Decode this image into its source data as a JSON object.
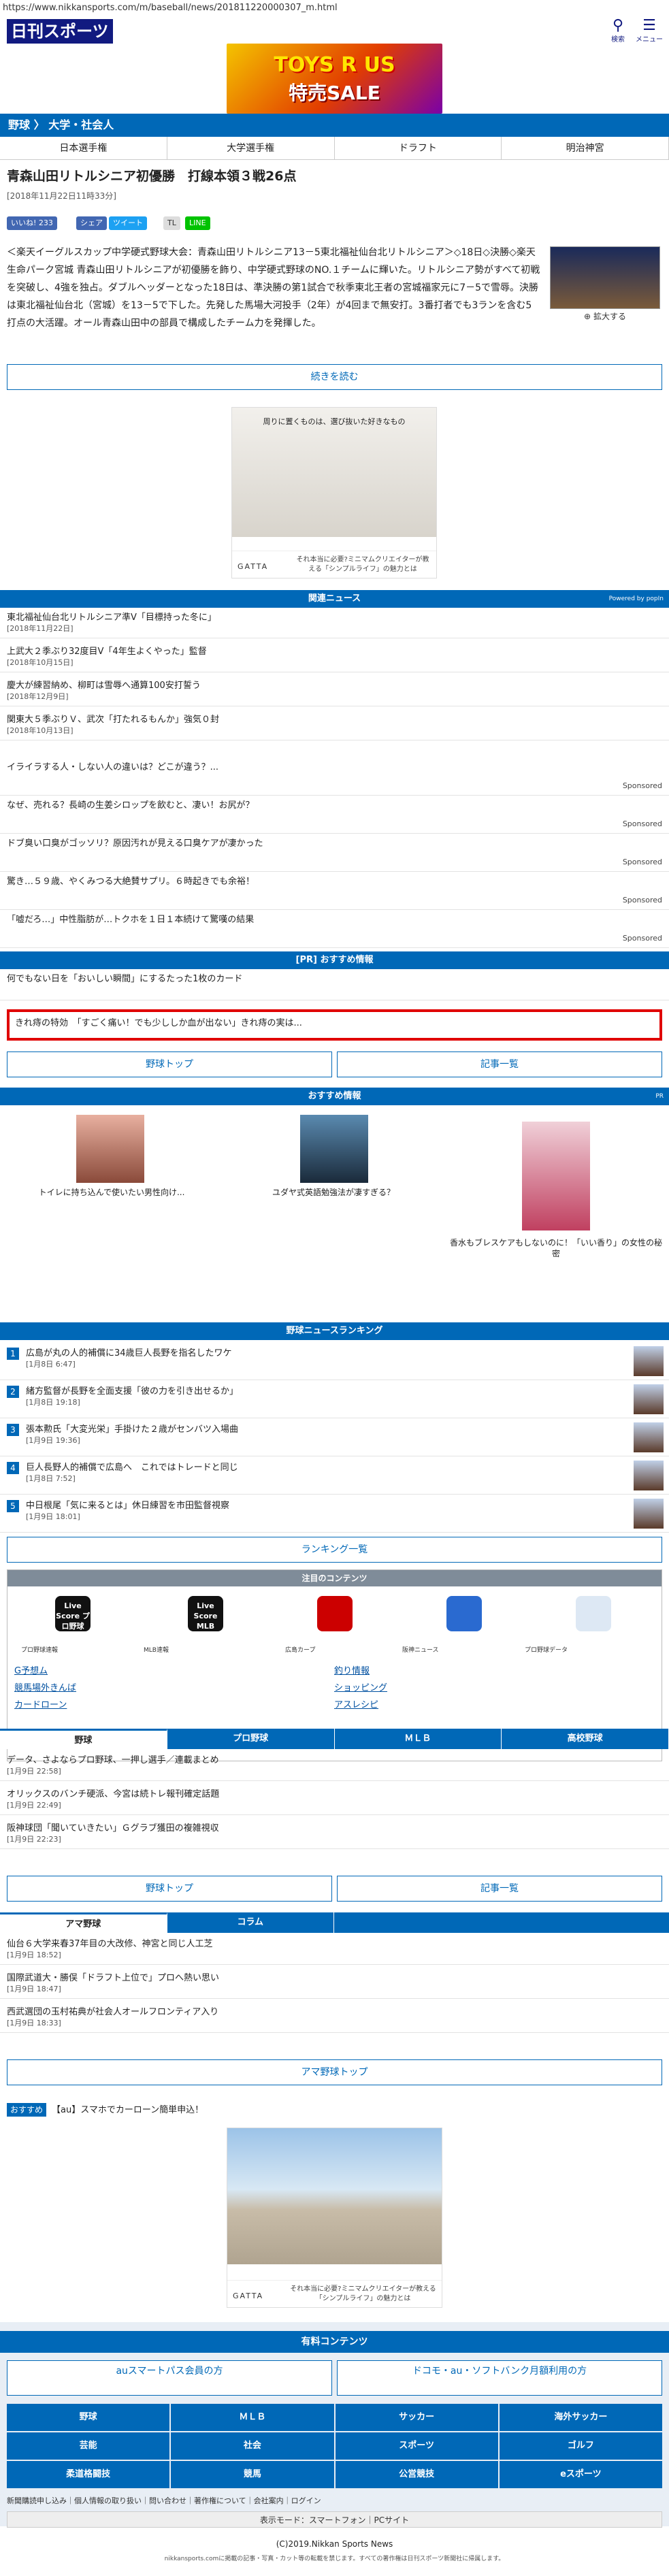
{
  "url": "https://www.nikkansports.com/m/baseball/news/201811220000307_m.html",
  "header": {
    "logo": "日刊スポーツ",
    "search": "検索",
    "menu": "メニュー"
  },
  "top_ad": {
    "brand": "TOYS R US",
    "headline": "特売SALE"
  },
  "breadcrumb": {
    "items": [
      "野球",
      "大学・社会人"
    ]
  },
  "subnav": [
    "日本選手権",
    "大学選手権",
    "ドラフト",
    "明治神宮"
  ],
  "article": {
    "title": "青森山田リトルシニア初優勝　打線本領３戦26点",
    "date": "[2018年11月22日11時33分]",
    "social": {
      "like": "いいね! 233",
      "share": "シェア",
      "tweet": "ツイート",
      "tl": "TL",
      "line": "LINE"
    },
    "body": "＜楽天イーグルスカップ中学硬式野球大会：青森山田リトルシニア13－5東北福祉仙台北リトルシニア＞◇18日◇決勝◇楽天生命パーク宮城 青森山田リトルシニアが初優勝を飾り、中学硬式野球のNO.１チームに輝いた。リトルシニア勢がすべて初戦を突破し、4強を独占。ダブルヘッダーとなった18日は、準決勝の第1試合で秋季東北王者の宮城福家元に7－5で雪辱。決勝は東北福祉仙台北（宮城）を13－5で下した。先発した馬場大河投手（2年）が4回まで無安打。3番打者でも3ランを含む5打点の大活躍。オール青森山田中の部員で構成したチーム力を発揮した。",
    "photo_caption": "拡大する",
    "continue": "続きを読む"
  },
  "ad1": {
    "tagline": "それ本当に必要?ミニマムクリエイターが教える「シンプルライフ」の魅力とは",
    "brand": "GATTA",
    "img_text": "周りに置くものは、選び抜いた好きなもの"
  },
  "related": {
    "header": "関連ニュース",
    "powered": "Powered by popIn",
    "items": [
      {
        "title": "東北福祉仙台北リトルシニア準V「目標持った冬に」",
        "date": "[2018年11月22日]"
      },
      {
        "title": "上武大２季ぶり32度目V「4年生よくやった」監督",
        "date": "[2018年10月15日]"
      },
      {
        "title": "慶大が練習納め、柳町は雪辱へ通算100安打誓う",
        "date": "[2018年12月9日]"
      },
      {
        "title": "関東大５季ぶりＶ、武次「打たれるもんか」強気０封",
        "date": "[2018年10月13日]"
      }
    ],
    "sponsored": [
      "イライラする人・しない人の違いは？どこが違う？...",
      "なぜ、売れる？長崎の生姜シロップを飲むと、凄い！お尻が？",
      "ドブ臭い口臭がゴッソリ？原因汚れが見える口臭ケアが凄かった",
      "驚き…５９歳、やくみつる大絶賛サプリ。６時起きでも余裕！",
      "「嘘だろ…」中性脂肪が…トクホを１日１本続けて驚嘆の結果"
    ],
    "sponsored_label": "Sponsored"
  },
  "pr": {
    "header": "[PR] おすすめ情報",
    "item": "何でもない日を「おいしい瞬間」にするたった1枚のカード",
    "red_item": "きれ痔の特効　「すごく痛い！でも少ししか血が出ない」きれ痔の実は..."
  },
  "buttons": {
    "baseball_top": "野球トップ",
    "article_list": "記事一覧"
  },
  "recommend": {
    "header": "おすすめ情報",
    "pr": "PR",
    "items": [
      "トイレに持ち込んで使いたい男性向け...",
      "ユダヤ式英語勉強法が凄すぎる？",
      "香水もブレスケアもしないのに！「いい香り」の女性の秘密"
    ]
  },
  "ranking": {
    "header": "野球ニュースランキング",
    "items": [
      {
        "title": "広島が丸の人的補償に34歳巨人長野を指名したワケ",
        "date": "[1月8日 6:47]"
      },
      {
        "title": "緒方監督が長野を全面支援「彼の力を引き出せるか」",
        "date": "[1月8日 19:18]"
      },
      {
        "title": "張本勲氏「大変光栄」手掛けた２歳がセンバツ入場曲",
        "date": "[1月9日 19:36]"
      },
      {
        "title": "巨人長野人的補償で広島へ　これではトレードと同じ",
        "date": "[1月8日 7:52]"
      },
      {
        "title": "中日根尾「気に来るとは」休日練習を市田監督視察",
        "date": "[1月9日 18:01]"
      }
    ],
    "more": "ランキング一覧"
  },
  "pickup": {
    "header": "注目のコンテンツ",
    "apps": [
      {
        "name": "Live Score プロ野球",
        "label": "プロ野球速報"
      },
      {
        "name": "Live Score MLB",
        "label": "MLB速報"
      },
      {
        "name": "",
        "label": "広島カープ"
      },
      {
        "name": "",
        "label": "阪神ニュース"
      },
      {
        "name": "",
        "label": "プロ野球データ"
      }
    ],
    "links": [
      [
        "G予想ム",
        "釣り情報"
      ],
      [
        "競馬場外きんば",
        "ショッピング"
      ],
      [
        "カードローン",
        "アスレシピ"
      ]
    ]
  },
  "tabs1": {
    "labels": [
      "野球",
      "プロ野球",
      "ＭＬＢ",
      "高校野球"
    ],
    "items": [
      {
        "title": "データ、さよならプロ野球、一押し選手／連載まとめ",
        "date": "[1月9日 22:58]"
      },
      {
        "title": "オリックスのバンチ硬派、今宮は続トレ報刊確定話題",
        "date": "[1月9日 22:49]"
      },
      {
        "title": "阪神球団「聞いていきたい」Ｇグラブ獲田の複雑視収",
        "date": "[1月9日 22:23]"
      }
    ]
  },
  "tabs2": {
    "labels": [
      "アマ野球",
      "コラム"
    ],
    "items": [
      {
        "title": "仙台６大学来春37年目の大改修、神宮と同じ人工芝",
        "date": "[1月9日 18:52]"
      },
      {
        "title": "国際武道大・勝俣「ドラフト上位で」プロへ熱い思い",
        "date": "[1月9日 18:47]"
      },
      {
        "title": "西武選団の玉村祐典が社会人オールフロンティア入り",
        "date": "[1月9日 18:33]"
      }
    ],
    "top": "アマ野球トップ"
  },
  "osusume": {
    "label": "おすすめ",
    "text": "【au】スマホでカーローン簡単申込！"
  },
  "paid": {
    "header": "有料コンテンツ",
    "left": "auスマートパス会員の方",
    "right": "ドコモ・au・ソフトバンク月額利用の方"
  },
  "footer_grid": [
    "野球",
    "ＭＬＢ",
    "サッカー",
    "海外サッカー",
    "芸能",
    "社会",
    "スポーツ",
    "ゴルフ",
    "柔道格闘技",
    "競馬",
    "公営競技",
    "eスポーツ"
  ],
  "footer_links": "新聞購読申し込み｜個人情報の取り扱い｜問い合わせ｜著作権について｜会社案内｜ログイン",
  "display_mode": "表示モード：スマートフォン｜PCサイト",
  "copyright": "(C)2019.Nikkan Sports News",
  "disclaimer": "nikkansports.comに掲載の記事・写真・カット等の転載を禁じます。すべての著作権は日刊スポーツ新聞社に帰属します。"
}
